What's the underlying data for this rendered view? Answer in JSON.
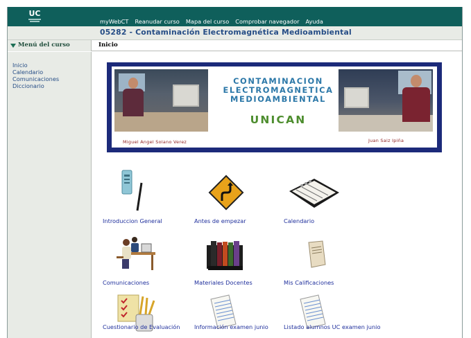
{
  "header": {
    "logo_text": "UC",
    "nav": [
      "myWebCT",
      "Reanudar curso",
      "Mapa del curso",
      "Comprobar navegador",
      "Ayuda"
    ]
  },
  "course": {
    "title": "05282 - Contaminación Electromagnética Medioambiental"
  },
  "menu": {
    "title": "Menú del curso",
    "items": [
      "Inicio",
      "Calendario",
      "Comunicaciones",
      "Diccionario"
    ]
  },
  "breadcrumb": "Inicio",
  "banner": {
    "title_lines": [
      "CONTAMINACION",
      "ELECTROMAGNETICA",
      "MEDIOAMBIENTAL"
    ],
    "subtitle": "UNICAN",
    "caption_left": "Miguel Angel Solano Verez",
    "caption_right": "Juan Saiz Ipiña"
  },
  "tools": [
    {
      "label": "Introduccion General",
      "icon": "thermometer-pen-icon"
    },
    {
      "label": "Antes de empezar",
      "icon": "winding-road-sign-icon"
    },
    {
      "label": "Calendario",
      "icon": "planner-icon"
    },
    {
      "label": "Comunicaciones",
      "icon": "people-at-desk-icon"
    },
    {
      "label": "Materiales Docentes",
      "icon": "book-binders-icon"
    },
    {
      "label": "Mis Calificaciones",
      "icon": "grade-booklet-icon"
    },
    {
      "label": "Cuestionario de Evaluación",
      "icon": "checklist-pencils-icon"
    },
    {
      "label": "Información examen junio",
      "icon": "notepad-icon"
    },
    {
      "label": "Listado alumnos UC examen junio",
      "icon": "notepad-icon"
    }
  ],
  "colors": {
    "header_bg": "#0f5f5b",
    "title_text": "#264d86",
    "link": "#1f2f9c",
    "banner_frame": "#1c2a7a"
  }
}
